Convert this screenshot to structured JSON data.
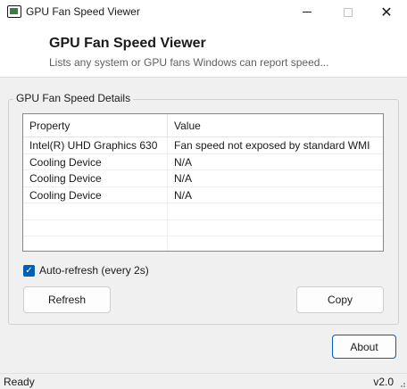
{
  "window": {
    "title": "GPU Fan Speed Viewer",
    "minimize_glyph": "minimize-icon",
    "maximize_glyph": "maximize-icon",
    "close_glyph": "✕"
  },
  "header": {
    "title": "GPU Fan Speed Viewer",
    "subtitle": "Lists any system or GPU fans Windows can report speed..."
  },
  "group": {
    "label": "GPU Fan Speed Details"
  },
  "table": {
    "columns": [
      "Property",
      "Value"
    ],
    "rows": [
      [
        "Intel(R) UHD Graphics 630",
        "Fan speed not exposed by standard WMI"
      ],
      [
        "Cooling Device",
        "N/A"
      ],
      [
        "Cooling Device",
        "N/A"
      ],
      [
        "Cooling Device",
        "N/A"
      ],
      [
        "",
        ""
      ],
      [
        "",
        ""
      ],
      [
        "",
        ""
      ]
    ]
  },
  "auto_refresh": {
    "label": "Auto-refresh (every 2s)",
    "checked": true
  },
  "buttons": {
    "refresh": "Refresh",
    "copy": "Copy",
    "about": "About"
  },
  "status": {
    "left": "Ready",
    "right": "v2.0"
  },
  "colors": {
    "accent": "#005fb8",
    "icon_green": "#3a7d44"
  }
}
